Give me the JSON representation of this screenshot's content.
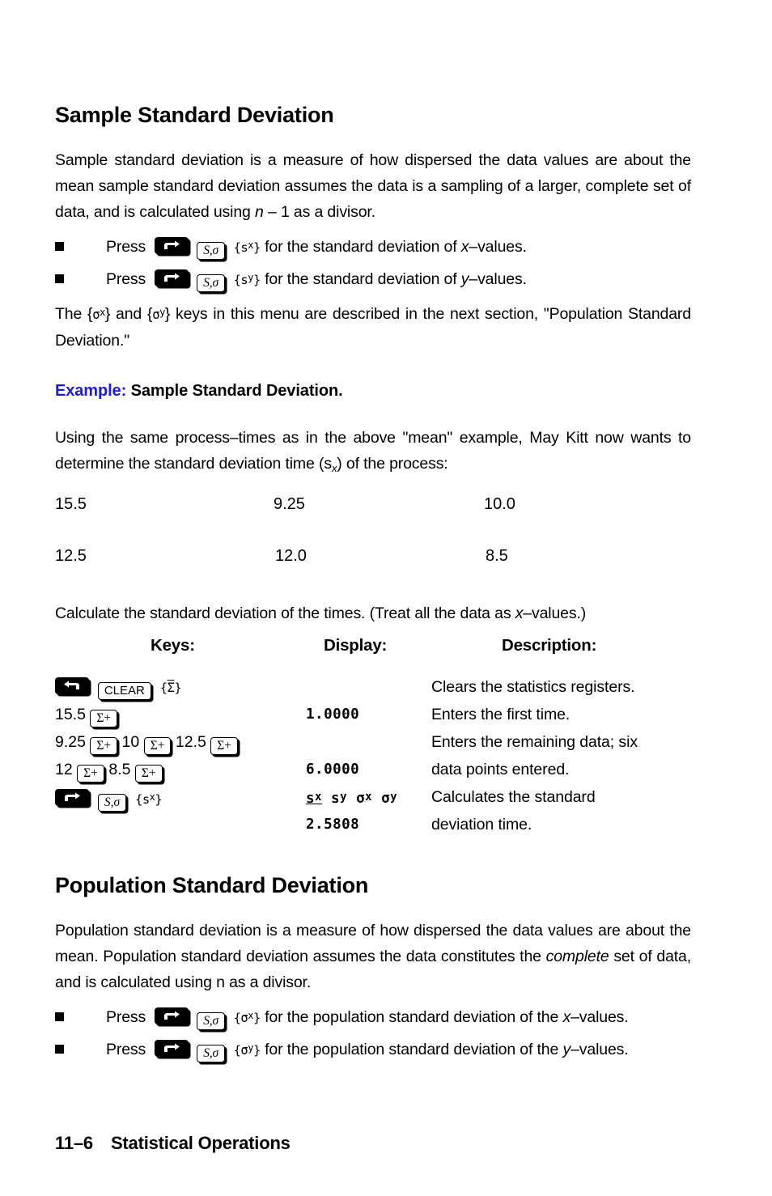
{
  "sections": {
    "sample": {
      "title": "Sample Standard Deviation",
      "intro": "Sample standard deviation is a measure of how dispersed the data values are about the mean sample standard deviation assumes the data is a sampling of a larger, complete set of data, and is calculated using ",
      "intro_italic_n": "n",
      "intro_tail": " – 1 as a divisor.",
      "bullets": [
        {
          "press_label": "Press",
          "key1": "right-shift-key",
          "key2": "S,σ",
          "menu": "{sx}",
          "menu_main": "s",
          "menu_sup": "x",
          "tail_pre": " for the standard deviation of ",
          "tail_italic": "x",
          "tail_post": "–values."
        },
        {
          "press_label": "Press",
          "key1": "right-shift-key",
          "key2": "S,σ",
          "menu": "{sy}",
          "menu_main": "s",
          "menu_sup": "y",
          "tail_pre": " for the standard deviation of ",
          "tail_italic": "y",
          "tail_post": "–values."
        }
      ],
      "note": "The {σx} and {σy} keys in this menu are described in the next section, \"Population Standard Deviation.\"",
      "note_pre": "The {",
      "note_k1": "σ",
      "note_k1sup": "x",
      "note_mid": "} and {",
      "note_k2": "σ",
      "note_k2sup": "y",
      "note_post": "} keys in this menu are described in the next section, \"Population Standard Deviation.\""
    },
    "example": {
      "label": "Example:",
      "title": "Sample Standard Deviation.",
      "intro_pre": "Using the same process–times as in the above \"mean\" example, May Kitt now wants to determine the standard deviation time (s",
      "intro_sub": "x",
      "intro_post": ") of the process:",
      "data_values": [
        [
          "15.5",
          "9.25",
          "10.0"
        ],
        [
          "12.5",
          "12.0",
          "8.5"
        ]
      ],
      "calc_instruction_pre": "Calculate the standard deviation of the times. (Treat all the data as ",
      "calc_instruction_italic": "x",
      "calc_instruction_post": "–values.)"
    },
    "keytable": {
      "headers": {
        "keys": "Keys:",
        "display": "Display:",
        "description": "Description:"
      },
      "rows": [
        {
          "keys_text": "[back-arrow] [CLEAR] {Σ̅}",
          "clear_label": "CLEAR",
          "menu_label": "Σ",
          "display": "",
          "description": "Clears the statistics registers."
        },
        {
          "keys_prefix": "15.5",
          "key_label": "Σ+",
          "display": "1.0000",
          "description": "Enters the first time."
        },
        {
          "keys_seq": [
            "9.25",
            "10",
            "12.5"
          ],
          "key_label": "Σ+",
          "display": "",
          "description": "Enters the remaining data; six"
        },
        {
          "keys_seq2": [
            "12",
            "8.5"
          ],
          "key_label": "Σ+",
          "display": "6.0000",
          "description": "data points entered."
        },
        {
          "key2_label": "S,σ",
          "menu": "{sx}",
          "menu_main": "s",
          "menu_sup": "x",
          "display_menu": [
            "sx",
            "sy",
            "σx",
            "σy"
          ],
          "display_menu_items": [
            {
              "main": "s",
              "sup": "x",
              "underline": true
            },
            {
              "main": "s",
              "sup": "y",
              "underline": false
            },
            {
              "main": "σ",
              "sup": "x",
              "underline": false
            },
            {
              "main": "σ",
              "sup": "y",
              "underline": false
            }
          ],
          "description": "Calculates the standard"
        },
        {
          "display": "2.5808",
          "description": "deviation time."
        }
      ]
    },
    "population": {
      "title": "Population Standard Deviation",
      "intro_pre": "Population standard deviation is a measure of how dispersed the data values are about the mean. Population standard deviation assumes the data constitutes the ",
      "intro_italic": "complete",
      "intro_post": " set of data, and is calculated using n as a divisor.",
      "bullets": [
        {
          "press_label": "Press",
          "key1": "right-shift-key",
          "key2": "S,σ",
          "menu_main": "σ",
          "menu_sup": "x",
          "tail_pre": " for the population standard deviation of the ",
          "tail_italic": "x",
          "tail_post": "–values."
        },
        {
          "press_label": "Press",
          "key1": "right-shift-key",
          "key2": "S,σ",
          "menu_main": "σ",
          "menu_sup": "y",
          "tail_pre": " for the population standard deviation of the ",
          "tail_italic": "y",
          "tail_post": "–values."
        }
      ]
    }
  },
  "footer": {
    "page_number": "11–6",
    "chapter_title": "Statistical Operations"
  },
  "colors": {
    "example_blue": "#1a1ae0",
    "text_black": "#000000",
    "background": "#ffffff"
  }
}
